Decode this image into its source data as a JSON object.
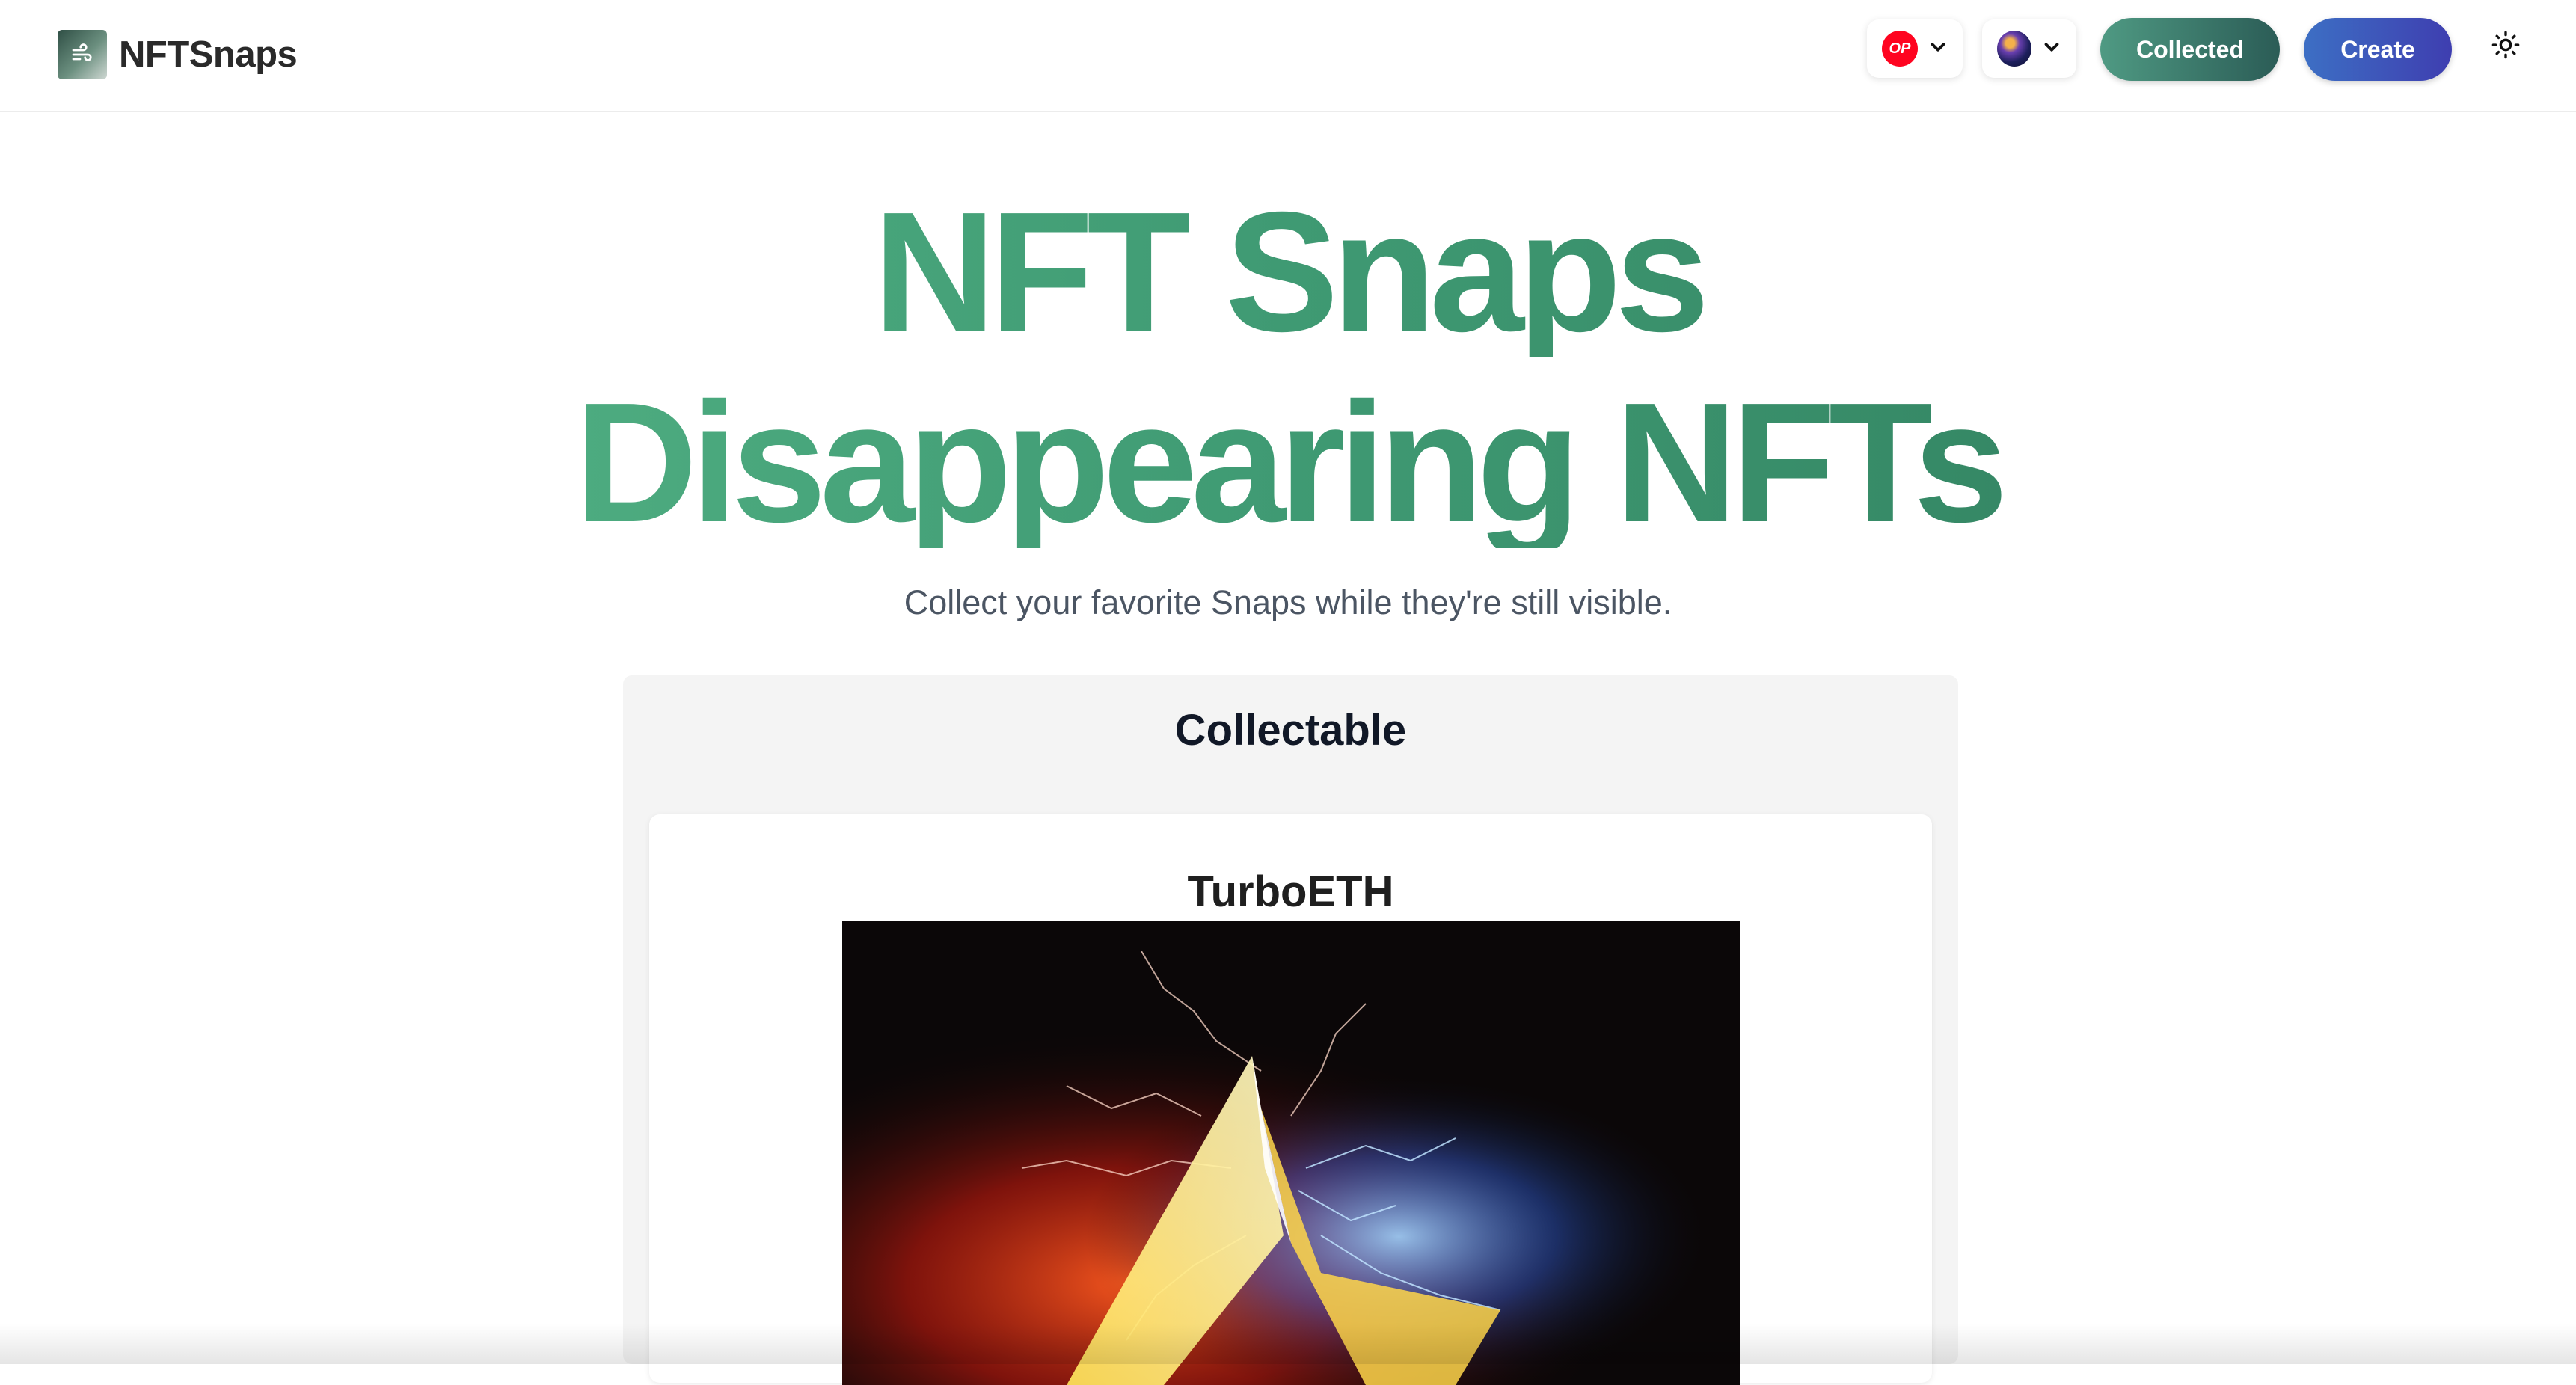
{
  "nav": {
    "brand_name": "NFTSnaps",
    "chain_badge": "OP",
    "collected_label": "Collected",
    "create_label": "Create"
  },
  "hero": {
    "title_line1": "NFT Snaps",
    "title_line2": "Disappearing NFTs",
    "subtitle": "Collect your favorite Snaps while they're still visible."
  },
  "collectable": {
    "heading": "Collectable",
    "items": [
      {
        "title": "TurboETH"
      }
    ]
  },
  "colors": {
    "hero_gradient_start": "#58b98a",
    "hero_gradient_end": "#2e7a5b",
    "collected_button": "#3a7a6a",
    "create_button": "#3d56bb",
    "optimism_red": "#ff0420"
  },
  "icons": {
    "brand": "wind-logo-icon",
    "chain_dropdown": "chevron-down-icon",
    "account_avatar": "account-avatar",
    "theme": "sun-icon"
  }
}
